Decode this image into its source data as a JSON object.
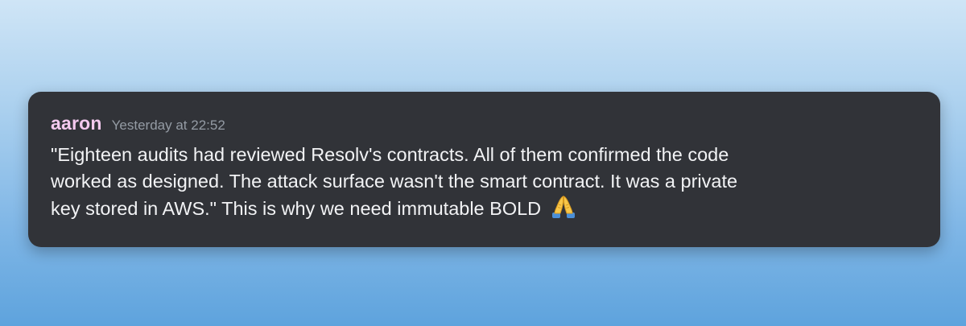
{
  "message": {
    "author": "aaron",
    "timestamp": "Yesterday at 22:52",
    "lines": [
      "\"Eighteen audits had reviewed Resolv's contracts. All of them confirmed the code",
      "worked as designed. The attack surface wasn't the smart contract. It was a private",
      "key stored in AWS.\" This is why we need immutable BOLD"
    ],
    "emoji": "folded-hands-icon"
  },
  "colors": {
    "username": "#f3c9ee",
    "card_background": "#313338",
    "message_text": "#f2f3f5",
    "timestamp": "#949ba4"
  }
}
